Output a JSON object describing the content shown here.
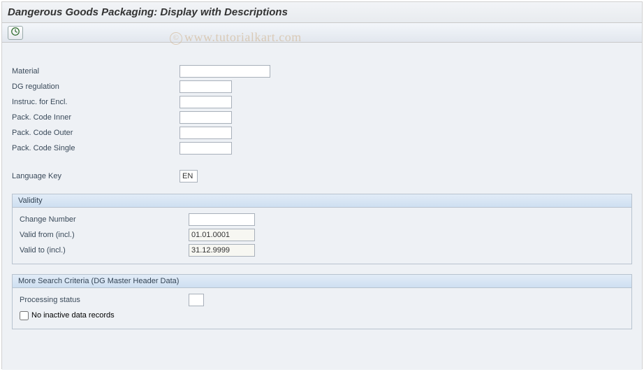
{
  "header": {
    "title": "Dangerous Goods Packaging: Display with Descriptions"
  },
  "watermark": "www.tutorialkart.com",
  "fields": {
    "material": {
      "label": "Material",
      "value": ""
    },
    "dg_regulation": {
      "label": "DG regulation",
      "value": ""
    },
    "instruc_encl": {
      "label": "Instruc. for Encl.",
      "value": ""
    },
    "pack_code_inner": {
      "label": "Pack. Code Inner",
      "value": ""
    },
    "pack_code_outer": {
      "label": "Pack. Code Outer",
      "value": ""
    },
    "pack_code_single": {
      "label": "Pack. Code Single",
      "value": ""
    },
    "language_key": {
      "label": "Language Key",
      "value": "EN"
    }
  },
  "validity": {
    "title": "Validity",
    "change_number": {
      "label": "Change Number",
      "value": ""
    },
    "valid_from": {
      "label": "Valid from (incl.)",
      "value": "01.01.0001"
    },
    "valid_to": {
      "label": "Valid to (incl.)",
      "value": "31.12.9999"
    }
  },
  "more_criteria": {
    "title": "More Search Criteria (DG Master Header Data)",
    "processing_status": {
      "label": "Processing status",
      "value": ""
    },
    "no_inactive": {
      "label": "No inactive data records",
      "checked": false
    }
  }
}
